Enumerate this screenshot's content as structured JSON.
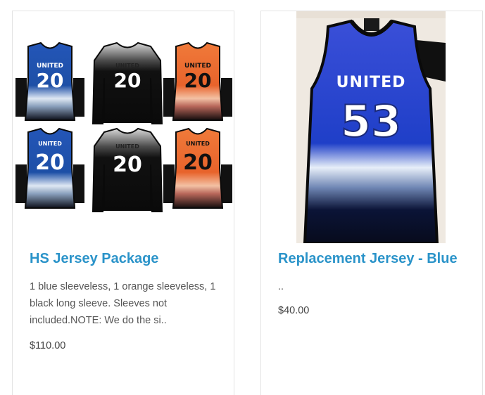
{
  "products": [
    {
      "title": "HS Jersey Package",
      "description": "1 blue sleeveless, 1 orange sleeveless, 1 black long sleeve. Sleeves not included.NOTE: We do the si..",
      "price": "$110.00",
      "jersey_team": "UNITED",
      "jersey_number": "20",
      "colors": {
        "blue": "#1d4fa6",
        "black": "#111111",
        "orange": "#e8632b"
      }
    },
    {
      "title": "Replacement Jersey - Blue",
      "description": "..",
      "price": "$40.00",
      "jersey_team": "UNITED",
      "jersey_number": "53",
      "colors": {
        "blue": "#1f3fc8",
        "navy": "#0b1437",
        "background": "#efe9e1"
      }
    }
  ],
  "accent_color": "#2a93c9"
}
